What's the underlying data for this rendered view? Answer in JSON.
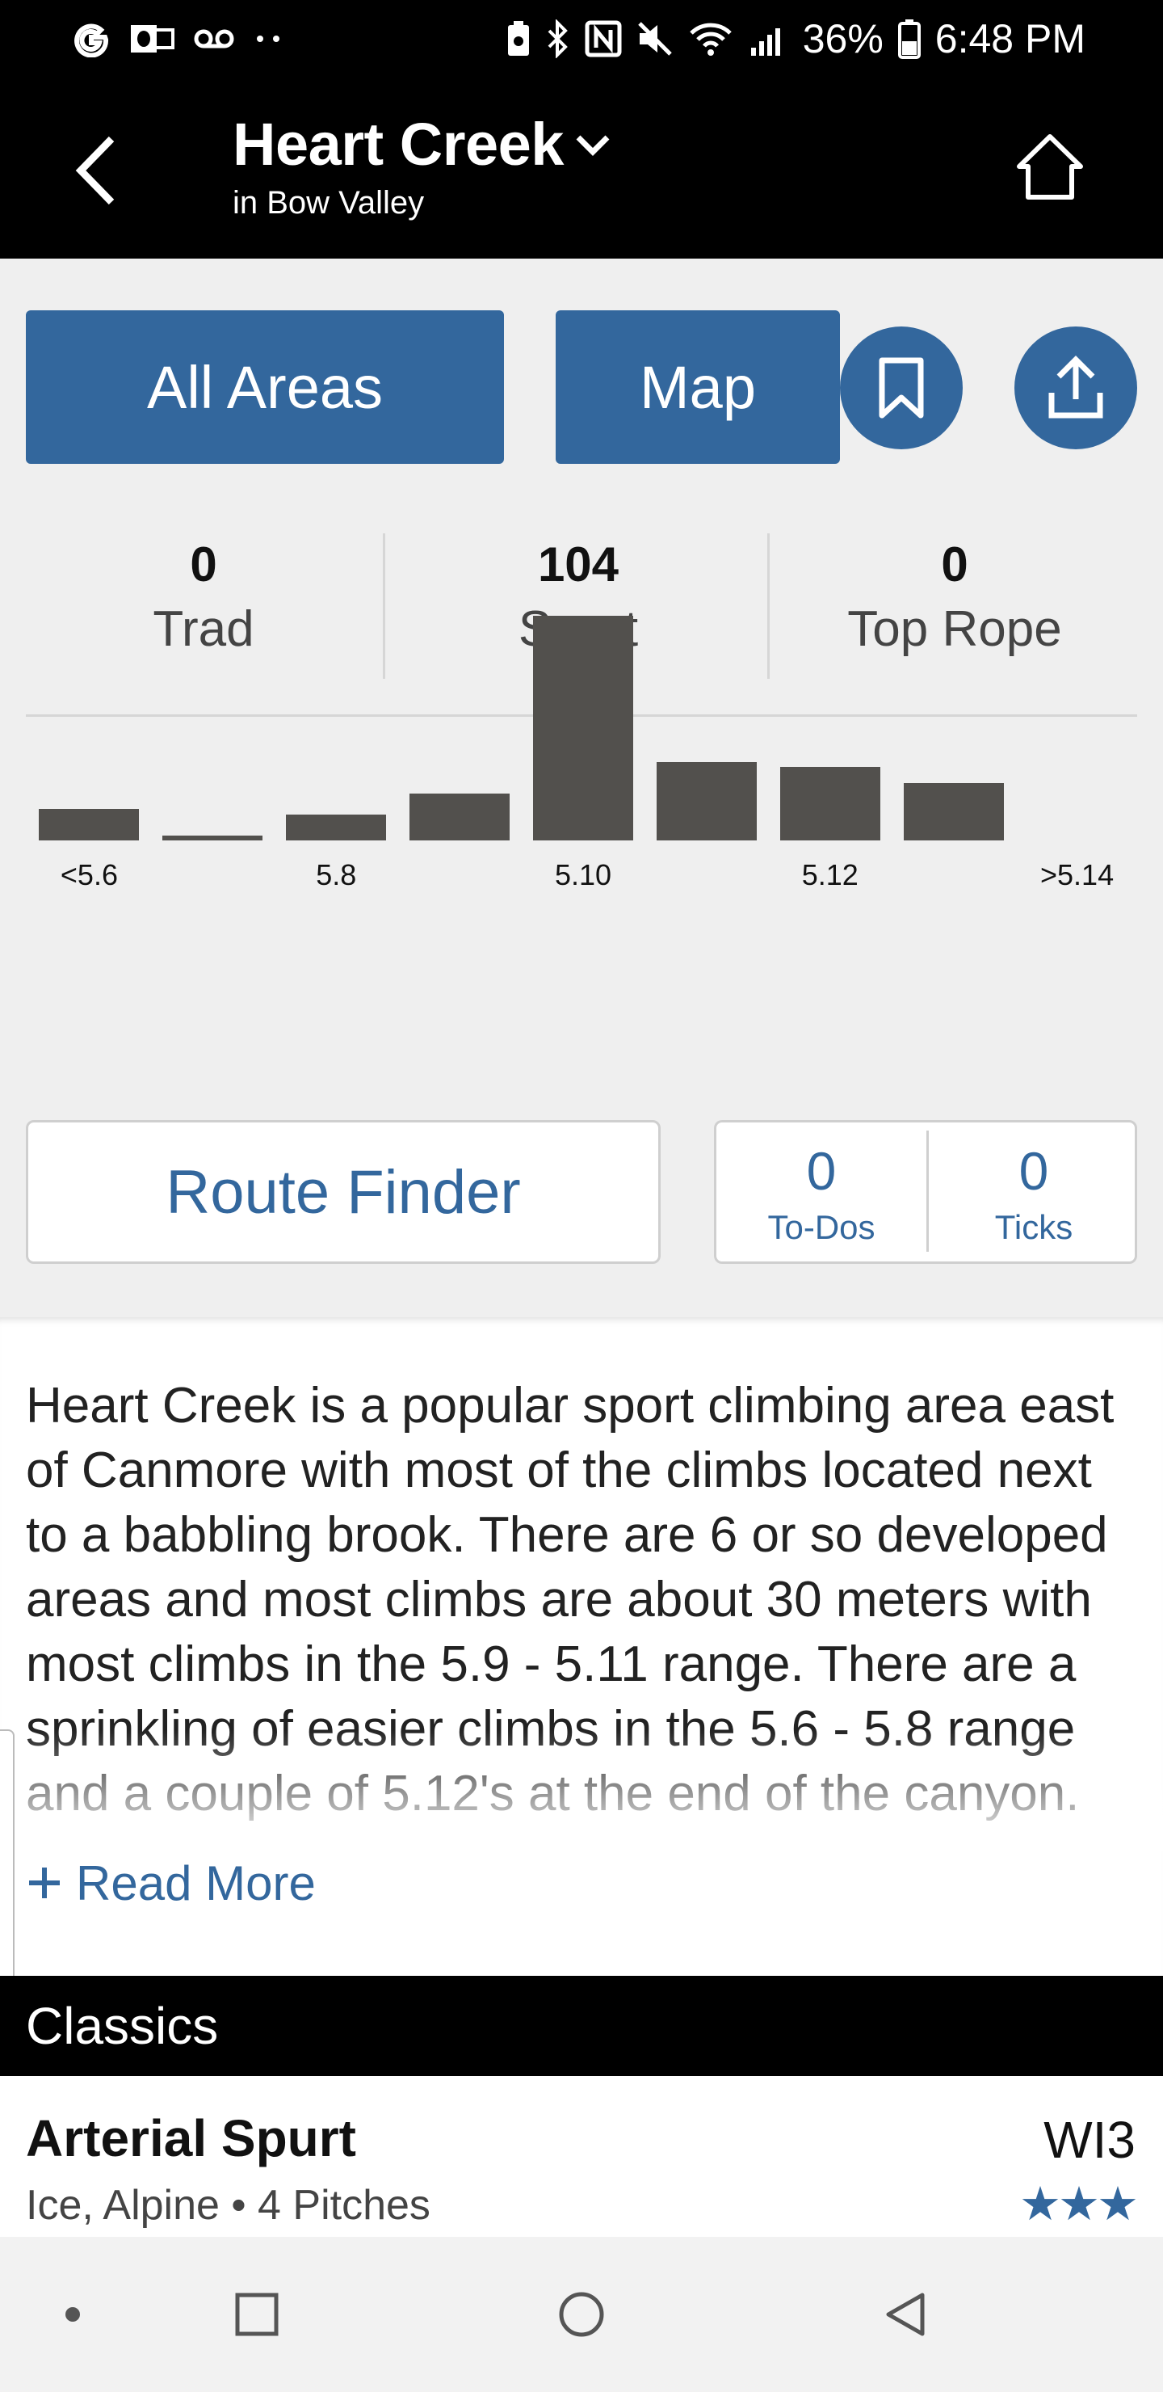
{
  "status_bar": {
    "battery": "36%",
    "time": "6:48 PM",
    "left_icons": [
      "google-icon",
      "outlook-icon",
      "voicemail-icon",
      "more-dots-icon"
    ],
    "right_icons": [
      "battery-saver-icon",
      "bluetooth-icon",
      "nfc-icon",
      "mute-icon",
      "wifi-icon",
      "signal-icon",
      "battery-icon"
    ]
  },
  "header": {
    "title": "Heart Creek",
    "subtitle": "in Bow Valley",
    "icons": [
      "back-icon",
      "chevron-down-icon",
      "home-icon"
    ]
  },
  "actions": {
    "all_areas": "All Areas",
    "map": "Map",
    "icons": [
      "bookmark-icon",
      "share-icon"
    ]
  },
  "counts": [
    {
      "value": "0",
      "label": "Trad"
    },
    {
      "value": "104",
      "label": "Sport"
    },
    {
      "value": "0",
      "label": "Top Rope"
    }
  ],
  "chart_data": {
    "type": "bar",
    "categories": [
      "<5.6",
      "5.7",
      "5.8",
      "5.9",
      "5.10",
      "5.11",
      "5.12",
      "5.13",
      ">5.14"
    ],
    "values": [
      6,
      1,
      5,
      9,
      43,
      15,
      14,
      11,
      0
    ],
    "tick_labels": [
      "<5.6",
      "5.8",
      "5.10",
      "5.12",
      ">5.14"
    ],
    "title": "",
    "xlabel": "",
    "ylabel": "",
    "grid": false,
    "bar_color": "#52504d"
  },
  "route_finder": "Route Finder",
  "tally": [
    {
      "value": "0",
      "label": "To-Dos"
    },
    {
      "value": "0",
      "label": "Ticks"
    }
  ],
  "description": "Heart Creek is a popular sport climbing area east of Canmore with most of the climbs located next to a babbling brook. There are 6 or so developed areas and most climbs are about 30 meters with most climbs in the 5.9 - 5.11 range. There are a sprinkling of easier climbs in the 5.6 - 5.8 range and a couple of 5.12's at the end of the canyon.",
  "read_more": "Read More",
  "classics": {
    "title": "Classics",
    "routes": [
      {
        "name": "Arterial Spurt",
        "meta": "Ice, Alpine • 4 Pitches",
        "grade": "WI3",
        "stars": "★★★"
      }
    ]
  },
  "colors": {
    "accent": "#33679d",
    "header_bg": "#000000",
    "bar": "#52504d"
  },
  "nav_icons": [
    "dot-icon",
    "recents-icon",
    "home-circle-icon",
    "back-triangle-icon"
  ]
}
